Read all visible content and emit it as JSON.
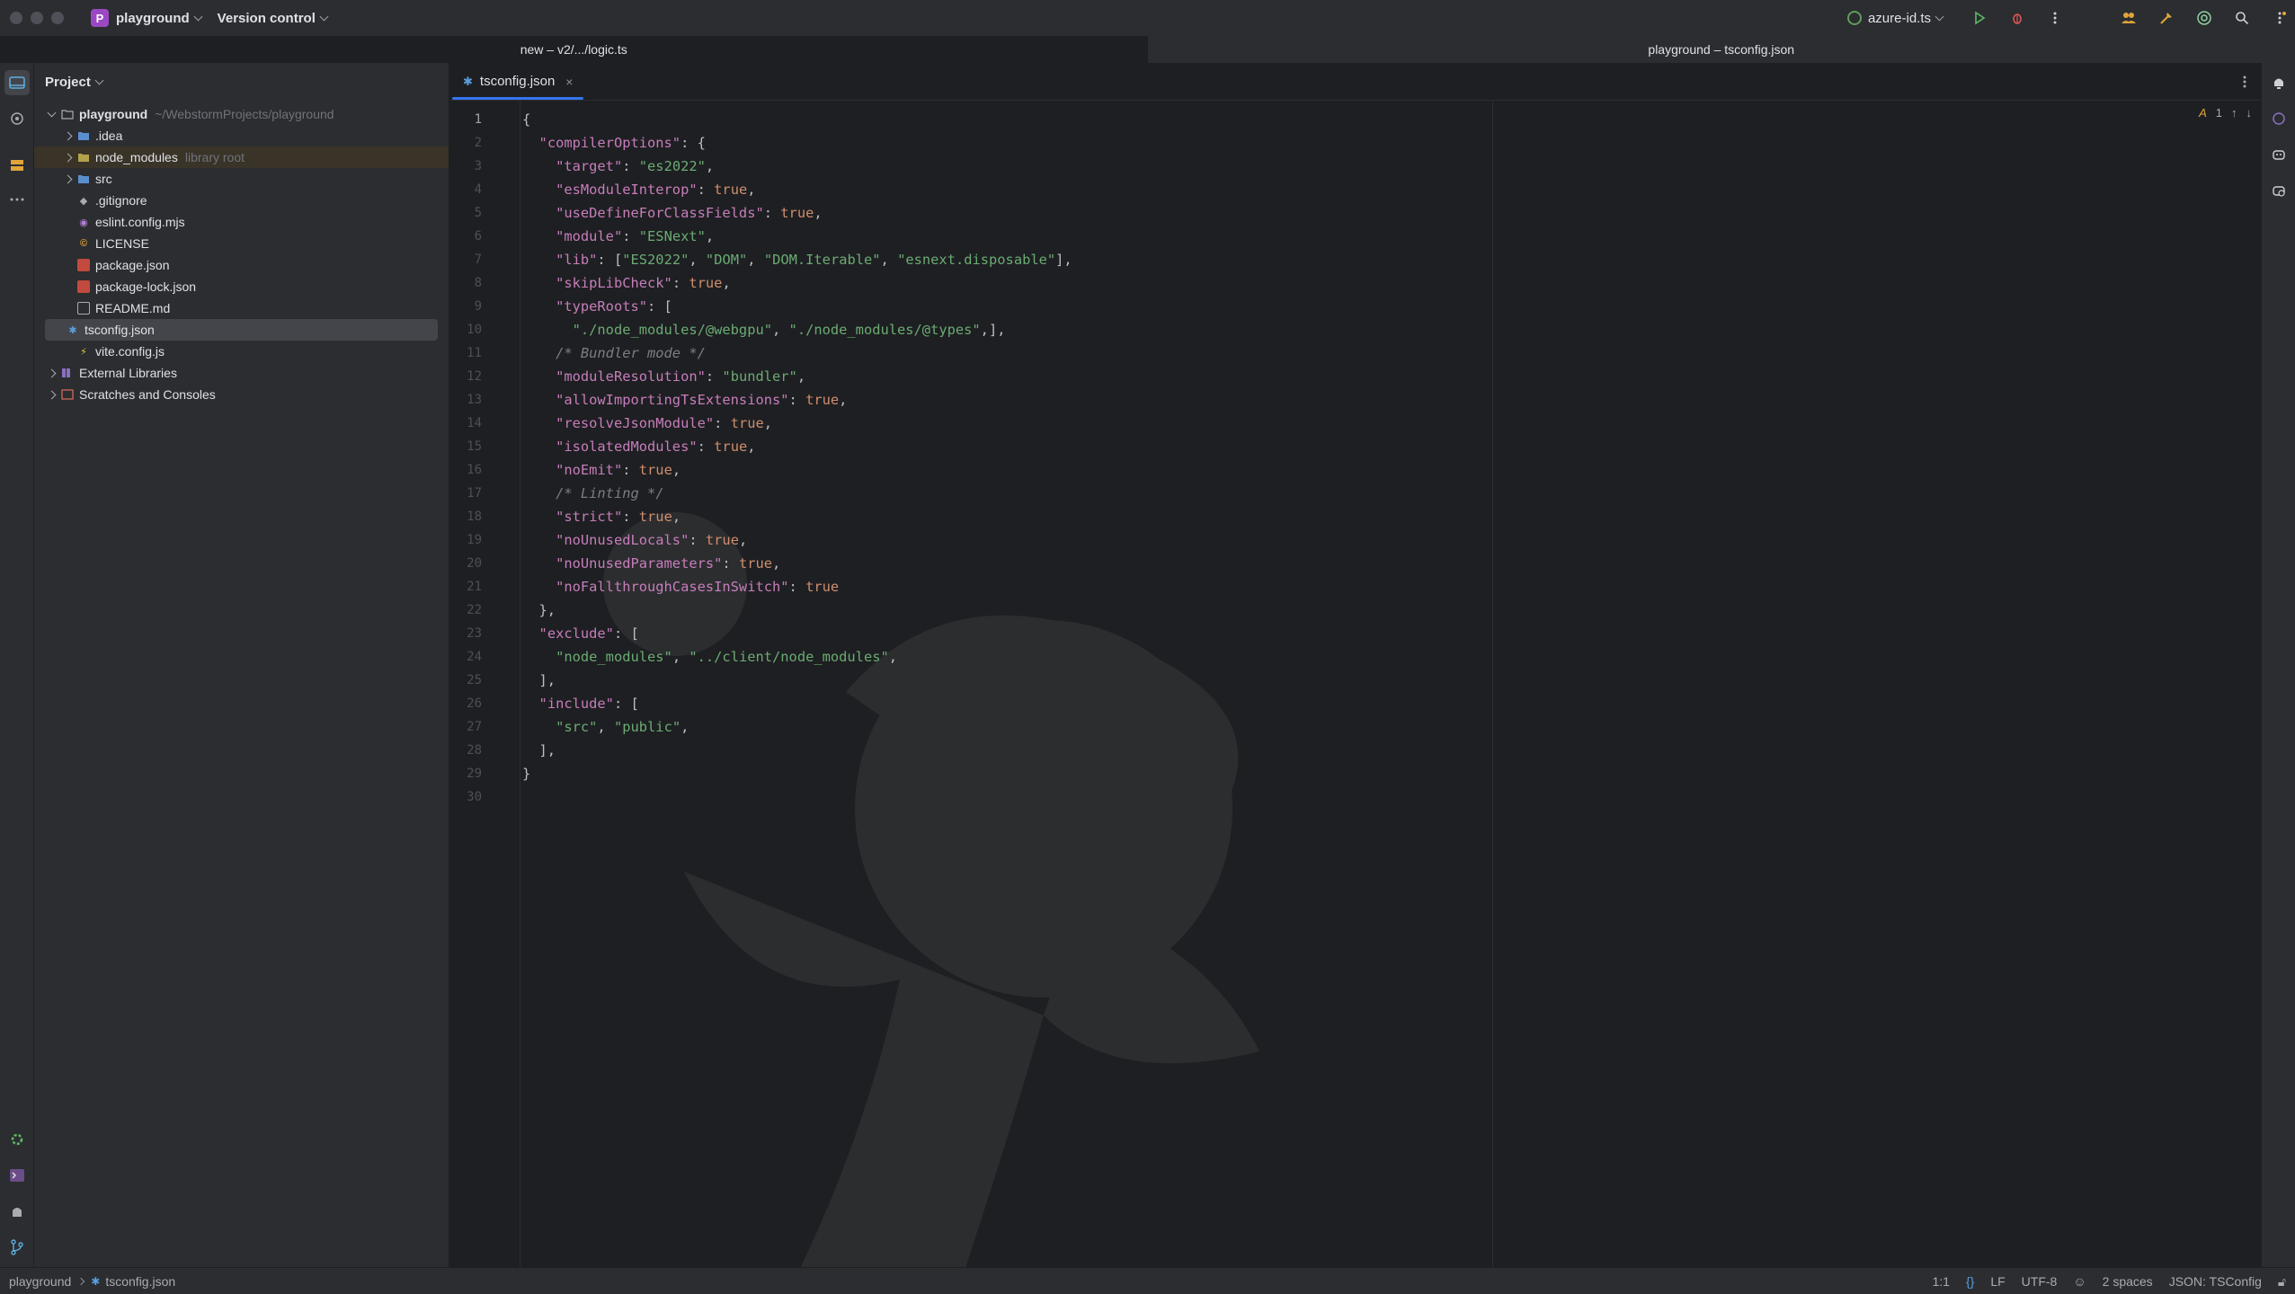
{
  "titlebar": {
    "project_badge": "P",
    "project_name": "playground",
    "vcs_menu": "Version control",
    "run_config": "azure-id.ts",
    "icons": [
      "run-icon",
      "debug-icon",
      "more-icon",
      "collab-icon",
      "build-icon",
      "ai-icon",
      "search-icon",
      "settings-icon"
    ]
  },
  "window_tabs": [
    {
      "label": "new – v2/.../logic.ts",
      "active": false
    },
    {
      "label": "playground – tsconfig.json",
      "active": true
    }
  ],
  "project_panel": {
    "title": "Project",
    "root": {
      "name": "playground",
      "path": "~/WebstormProjects/playground"
    },
    "items": [
      {
        "name": ".idea",
        "type": "folder"
      },
      {
        "name": "node_modules",
        "type": "folder",
        "note": "library root"
      },
      {
        "name": "src",
        "type": "folder"
      },
      {
        "name": ".gitignore",
        "type": "file"
      },
      {
        "name": "eslint.config.mjs",
        "type": "file"
      },
      {
        "name": "LICENSE",
        "type": "file"
      },
      {
        "name": "package.json",
        "type": "file"
      },
      {
        "name": "package-lock.json",
        "type": "file"
      },
      {
        "name": "README.md",
        "type": "file"
      },
      {
        "name": "tsconfig.json",
        "type": "file"
      },
      {
        "name": "vite.config.js",
        "type": "file"
      }
    ],
    "external_libraries": "External Libraries",
    "scratches": "Scratches and Consoles"
  },
  "editor": {
    "tab_label": "tsconfig.json",
    "tab_close": "×",
    "inspection_count": "1",
    "lines": [
      [
        [
          "p",
          "{"
        ]
      ],
      [
        [
          "p",
          "  "
        ],
        [
          "k",
          "\"compilerOptions\""
        ],
        [
          "p",
          ": {"
        ]
      ],
      [
        [
          "p",
          "    "
        ],
        [
          "k",
          "\"target\""
        ],
        [
          "p",
          ": "
        ],
        [
          "s",
          "\"es2022\""
        ],
        [
          "p",
          ","
        ]
      ],
      [
        [
          "p",
          "    "
        ],
        [
          "k",
          "\"esModuleInterop\""
        ],
        [
          "p",
          ": "
        ],
        [
          "b",
          "true"
        ],
        [
          "p",
          ","
        ]
      ],
      [
        [
          "p",
          "    "
        ],
        [
          "k",
          "\"useDefineForClassFields\""
        ],
        [
          "p",
          ": "
        ],
        [
          "b",
          "true"
        ],
        [
          "p",
          ","
        ]
      ],
      [
        [
          "p",
          "    "
        ],
        [
          "k",
          "\"module\""
        ],
        [
          "p",
          ": "
        ],
        [
          "s",
          "\"ESNext\""
        ],
        [
          "p",
          ","
        ]
      ],
      [
        [
          "p",
          "    "
        ],
        [
          "k",
          "\"lib\""
        ],
        [
          "p",
          ": ["
        ],
        [
          "s",
          "\"ES2022\""
        ],
        [
          "p",
          ", "
        ],
        [
          "s",
          "\"DOM\""
        ],
        [
          "p",
          ", "
        ],
        [
          "s",
          "\"DOM.Iterable\""
        ],
        [
          "p",
          ", "
        ],
        [
          "s",
          "\"esnext.disposable\""
        ],
        [
          "p",
          "],"
        ]
      ],
      [
        [
          "p",
          "    "
        ],
        [
          "k",
          "\"skipLibCheck\""
        ],
        [
          "p",
          ": "
        ],
        [
          "b",
          "true"
        ],
        [
          "p",
          ","
        ]
      ],
      [
        [
          "p",
          "    "
        ],
        [
          "k",
          "\"typeRoots\""
        ],
        [
          "p",
          ": ["
        ]
      ],
      [
        [
          "p",
          "      "
        ],
        [
          "s",
          "\"./node_modules/@webgpu\""
        ],
        [
          "p",
          ", "
        ],
        [
          "s",
          "\"./node_modules/@types\""
        ],
        [
          "p",
          ",],"
        ]
      ],
      [
        [
          "p",
          "    "
        ],
        [
          "c",
          "/* Bundler mode */"
        ]
      ],
      [
        [
          "p",
          "    "
        ],
        [
          "k",
          "\"moduleResolution\""
        ],
        [
          "p",
          ": "
        ],
        [
          "s",
          "\"bundler\""
        ],
        [
          "p",
          ","
        ]
      ],
      [
        [
          "p",
          "    "
        ],
        [
          "k",
          "\"allowImportingTsExtensions\""
        ],
        [
          "p",
          ": "
        ],
        [
          "b",
          "true"
        ],
        [
          "p",
          ","
        ]
      ],
      [
        [
          "p",
          "    "
        ],
        [
          "k",
          "\"resolveJsonModule\""
        ],
        [
          "p",
          ": "
        ],
        [
          "b",
          "true"
        ],
        [
          "p",
          ","
        ]
      ],
      [
        [
          "p",
          "    "
        ],
        [
          "k",
          "\"isolatedModules\""
        ],
        [
          "p",
          ": "
        ],
        [
          "b",
          "true"
        ],
        [
          "p",
          ","
        ]
      ],
      [
        [
          "p",
          "    "
        ],
        [
          "k",
          "\"noEmit\""
        ],
        [
          "p",
          ": "
        ],
        [
          "b",
          "true"
        ],
        [
          "p",
          ","
        ]
      ],
      [
        [
          "p",
          "    "
        ],
        [
          "c",
          "/* Linting */"
        ]
      ],
      [
        [
          "p",
          "    "
        ],
        [
          "k",
          "\"strict\""
        ],
        [
          "p",
          ": "
        ],
        [
          "b",
          "true"
        ],
        [
          "p",
          ","
        ]
      ],
      [
        [
          "p",
          "    "
        ],
        [
          "k",
          "\"noUnusedLocals\""
        ],
        [
          "p",
          ": "
        ],
        [
          "b",
          "true"
        ],
        [
          "p",
          ","
        ]
      ],
      [
        [
          "p",
          "    "
        ],
        [
          "k",
          "\"noUnusedParameters\""
        ],
        [
          "p",
          ": "
        ],
        [
          "b",
          "true"
        ],
        [
          "p",
          ","
        ]
      ],
      [
        [
          "p",
          "    "
        ],
        [
          "k",
          "\"noFallthroughCasesInSwitch\""
        ],
        [
          "p",
          ": "
        ],
        [
          "b",
          "true"
        ]
      ],
      [
        [
          "p",
          "  },"
        ]
      ],
      [
        [
          "p",
          "  "
        ],
        [
          "k",
          "\"exclude\""
        ],
        [
          "p",
          ": ["
        ]
      ],
      [
        [
          "p",
          "    "
        ],
        [
          "s",
          "\"node_modules\""
        ],
        [
          "p",
          ", "
        ],
        [
          "s",
          "\"../client/node_modules\""
        ],
        [
          "p",
          ","
        ]
      ],
      [
        [
          "p",
          "  ],"
        ]
      ],
      [
        [
          "p",
          "  "
        ],
        [
          "k",
          "\"include\""
        ],
        [
          "p",
          ": ["
        ]
      ],
      [
        [
          "p",
          "    "
        ],
        [
          "s",
          "\"src\""
        ],
        [
          "p",
          ", "
        ],
        [
          "s",
          "\"public\""
        ],
        [
          "p",
          ","
        ]
      ],
      [
        [
          "p",
          "  ],"
        ]
      ],
      [
        [
          "p",
          "}"
        ]
      ],
      [
        [
          "p",
          ""
        ]
      ]
    ]
  },
  "statusbar": {
    "breadcrumb_project": "playground",
    "breadcrumb_file": "tsconfig.json",
    "position": "1:1",
    "line_separator": "LF",
    "encoding": "UTF-8",
    "indent": "2 spaces",
    "schema": "JSON: TSConfig"
  }
}
